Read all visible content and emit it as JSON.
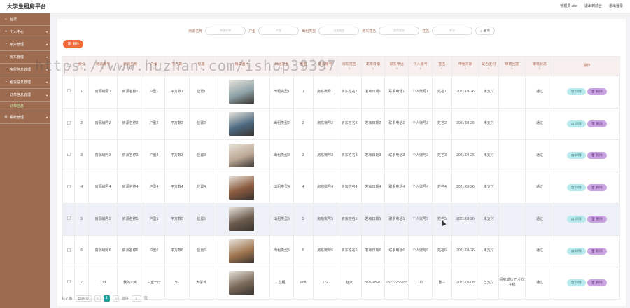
{
  "app": {
    "title": "大学生租房平台"
  },
  "header": {
    "user_label": "管理员 abo",
    "back_link": "退出到前台",
    "logout_link": "退出登录"
  },
  "sidebar": {
    "items": [
      {
        "label": "首页",
        "icon": "home-icon"
      },
      {
        "label": "个人中心",
        "icon": "user-icon"
      },
      {
        "label": "用户管理",
        "icon": "users-icon"
      },
      {
        "label": "房东管理",
        "icon": "landlord-icon"
      },
      {
        "label": "房屋信息管理",
        "icon": "house-icon"
      },
      {
        "label": "租赁信息管理",
        "icon": "lease-icon"
      },
      {
        "label": "订单信息管理",
        "icon": "order-icon"
      }
    ],
    "sub_item": "订单信息",
    "last_item": "系统管理"
  },
  "search": {
    "fields": [
      {
        "label": "房源名称",
        "placeholder": "房源名称"
      },
      {
        "label": "户型",
        "placeholder": "户型"
      },
      {
        "label": "出租类型",
        "placeholder": "出租类型"
      },
      {
        "label": "房东姓名",
        "placeholder": "房东姓名"
      },
      {
        "label": "姓名",
        "placeholder": "姓名"
      }
    ],
    "button": "查询"
  },
  "toolbar": {
    "delete_label": "删除"
  },
  "table": {
    "columns": [
      "索引",
      "房源编号",
      "房源名称",
      "户型",
      "平方数",
      "位置",
      "相关图片",
      "出租类型",
      "租金",
      "房东账号",
      "房东姓名",
      "发布日期",
      "联系电话",
      "个人账号",
      "姓名",
      "申租日期",
      "是否支付",
      "审核回复",
      "审核状态",
      "操作"
    ],
    "rows": [
      {
        "idx": "1",
        "code": "房源编号1",
        "name": "房源名称1",
        "type": "户型1",
        "area": "平方数1",
        "loc": "位置1",
        "rent_type": "出租类型1",
        "rent": "1",
        "owner_acc": "房东账号1",
        "owner": "房东姓名1",
        "pub": "发布日期1",
        "phone": "联系电话1",
        "acc": "个人账号1",
        "person": "姓名1",
        "date": "2021-03-26",
        "paid": "未支付",
        "reply": "",
        "status": "通过",
        "photo": "#8fa3a8"
      },
      {
        "idx": "2",
        "code": "房源编号2",
        "name": "房源名称2",
        "type": "户型2",
        "area": "平方数2",
        "loc": "位置2",
        "rent_type": "出租类型2",
        "rent": "2",
        "owner_acc": "房东账号2",
        "owner": "房东姓名2",
        "pub": "发布日期2",
        "phone": "联系电话2",
        "acc": "个人账号2",
        "person": "姓名2",
        "date": "2021-03-26",
        "paid": "未支付",
        "reply": "",
        "status": "通过",
        "photo": "#4d6a82"
      },
      {
        "idx": "3",
        "code": "房源编号3",
        "name": "房源名称3",
        "type": "户型3",
        "area": "平方数3",
        "loc": "位置3",
        "rent_type": "出租类型3",
        "rent": "3",
        "owner_acc": "房东账号3",
        "owner": "房东姓名3",
        "pub": "发布日期3",
        "phone": "联系电话3",
        "acc": "个人账号3",
        "person": "姓名3",
        "date": "2021-03-26",
        "paid": "未支付",
        "reply": "",
        "status": "通过",
        "photo": "#bca894"
      },
      {
        "idx": "4",
        "code": "房源编号4",
        "name": "房源名称4",
        "type": "户型4",
        "area": "平方数4",
        "loc": "位置4",
        "rent_type": "出租类型4",
        "rent": "4",
        "owner_acc": "房东账号4",
        "owner": "房东姓名4",
        "pub": "发布日期4",
        "phone": "联系电话4",
        "acc": "个人账号4",
        "person": "姓名4",
        "date": "2021-03-26",
        "paid": "未支付",
        "reply": "",
        "status": "通过",
        "photo": "#8b5a3e"
      },
      {
        "idx": "5",
        "code": "房源编号5",
        "name": "房源名称5",
        "type": "户型5",
        "area": "平方数5",
        "loc": "位置5",
        "rent_type": "出租类型5",
        "rent": "5",
        "owner_acc": "房东账号5",
        "owner": "房东姓名5",
        "pub": "发布日期5",
        "phone": "联系电话5",
        "acc": "个人账号5",
        "person": "姓名5",
        "date": "2021-03-26",
        "paid": "未支付",
        "reply": "",
        "status": "通过",
        "photo": "#6b5a4c"
      },
      {
        "idx": "6",
        "code": "房源编号6",
        "name": "房源名称6",
        "type": "户型6",
        "area": "平方数6",
        "loc": "位置6",
        "rent_type": "出租类型6",
        "rent": "6",
        "owner_acc": "房东账号6",
        "owner": "房东姓名6",
        "pub": "发布日期6",
        "phone": "联系电话6",
        "acc": "个人账号6",
        "person": "姓名6",
        "date": "2021-03-26",
        "paid": "未支付",
        "reply": "",
        "status": "通过",
        "photo": "#a07650"
      },
      {
        "idx": "7",
        "code": "123",
        "name": "我的公寓",
        "type": "三室一厅",
        "area": "93",
        "loc": "大学城",
        "rent_type": "直租",
        "rent": "888",
        "owner_acc": "222",
        "owner": "赵六",
        "pub": "2021-05-01",
        "phone": "13222255555",
        "acc": "111",
        "person": "张三",
        "date": "2021-05-08",
        "paid": "已支付",
        "reply": "租房成功了,小伙子稳",
        "status": "通过",
        "photo": "#7b6a5a"
      }
    ],
    "detail_label": "详情",
    "delete_label": "删除"
  },
  "pagination": {
    "total": "共 7 条",
    "page_size": "10条/页",
    "prev": "<",
    "current": "1",
    "next": ">",
    "goto": "前往",
    "page_input": "1",
    "page_unit": "页"
  },
  "watermark": "https://www.huzhan.com/ishop39397"
}
